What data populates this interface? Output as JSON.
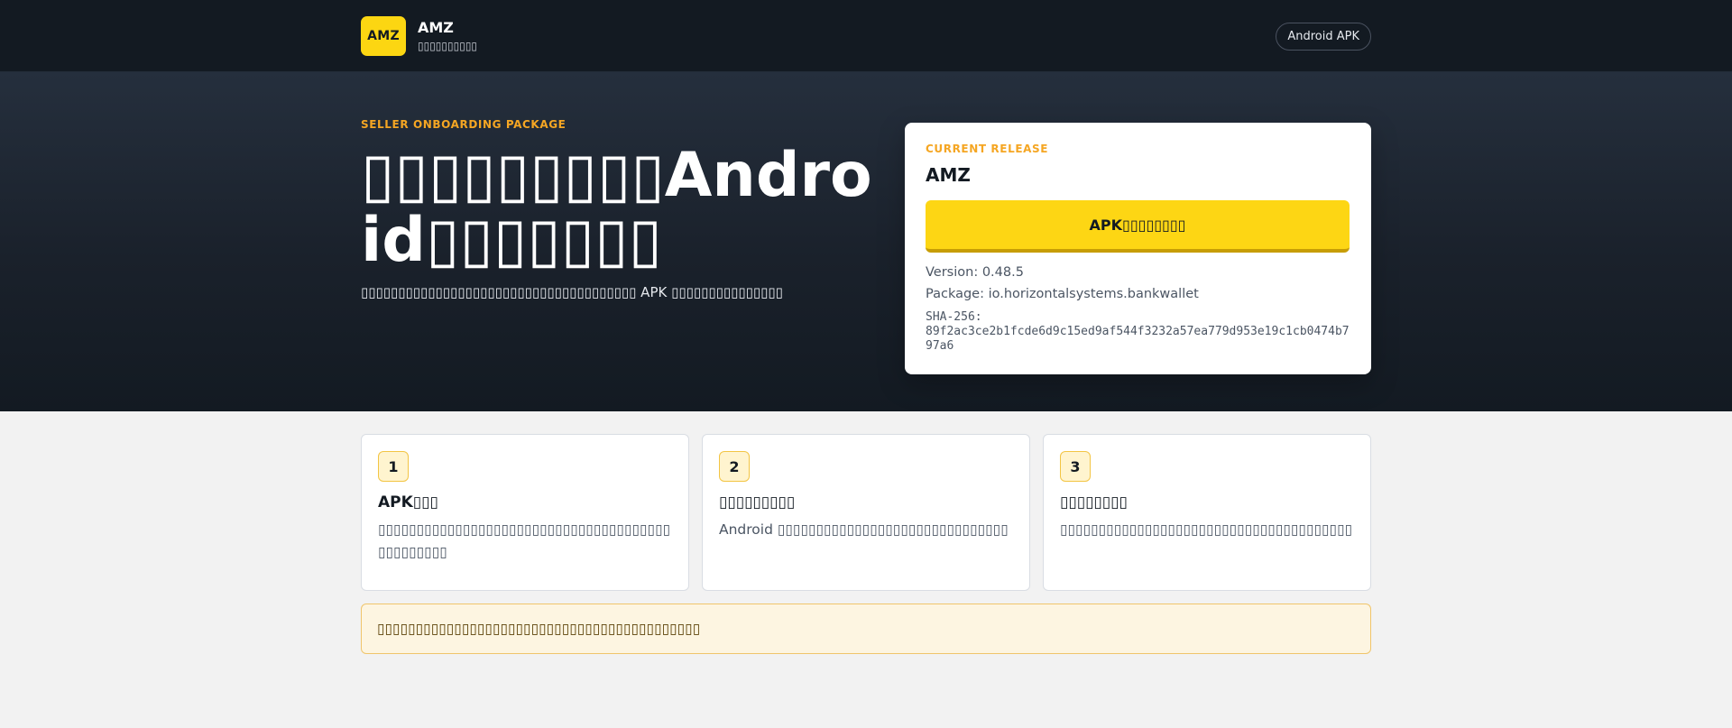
{
  "header": {
    "logo_text": "AMZ",
    "brand_name": "AMZ",
    "brand_sub": "▯▯▯▯▯▯▯▯▯▯",
    "nav_pill": "Android APK"
  },
  "hero": {
    "eyebrow": "SELLER ONBOARDING PACKAGE",
    "headline": "▯▯▯▯▯▯▯▯▯Android▯▯▯▯▯▯▯",
    "description": "▯▯▯▯▯▯▯▯▯▯▯▯▯▯▯▯▯▯▯▯▯▯▯▯▯▯▯▯▯▯▯▯▯▯▯▯▯ APK ▯▯▯▯▯▯▯▯▯▯▯▯▯▯▯"
  },
  "release": {
    "eyebrow": "CURRENT RELEASE",
    "title": "AMZ",
    "download_label": "APK▯▯▯▯▯▯▯▯",
    "version": "Version: 0.48.5",
    "package": "Package: io.horizontalsystems.bankwallet",
    "sha_label": "SHA-256:",
    "sha_value": "89f2ac3ce2b1fcde6d9c15ed9af544f3232a57ea779d953e19c1cb0474b797a6"
  },
  "steps": [
    {
      "num": "1",
      "title": "APK▯▯▯",
      "body": "▯▯▯▯▯▯▯▯▯▯▯▯▯▯▯▯▯▯▯▯▯▯▯▯▯▯▯▯▯▯▯▯▯▯▯▯▯▯▯▯▯▯▯▯▯▯▯"
    },
    {
      "num": "2",
      "title": "▯▯▯▯▯▯▯▯▯",
      "body": "Android ▯▯▯▯▯▯▯▯▯▯▯▯▯▯▯▯▯▯▯▯▯▯▯▯▯▯▯▯▯▯"
    },
    {
      "num": "3",
      "title": "▯▯▯▯▯▯▯▯",
      "body": "▯▯▯▯▯▯▯▯▯▯▯▯▯▯▯▯▯▯▯▯▯▯▯▯▯▯▯▯▯▯▯▯▯▯▯▯▯▯"
    }
  ],
  "notice": "▯▯▯▯▯▯▯▯▯▯▯▯▯▯▯▯▯▯▯▯▯▯▯▯▯▯▯▯▯▯▯▯▯▯▯▯▯▯▯▯▯▯",
  "colors": {
    "accent": "#fdd614",
    "eyebrow": "#f5a623",
    "dark": "#131a22"
  }
}
